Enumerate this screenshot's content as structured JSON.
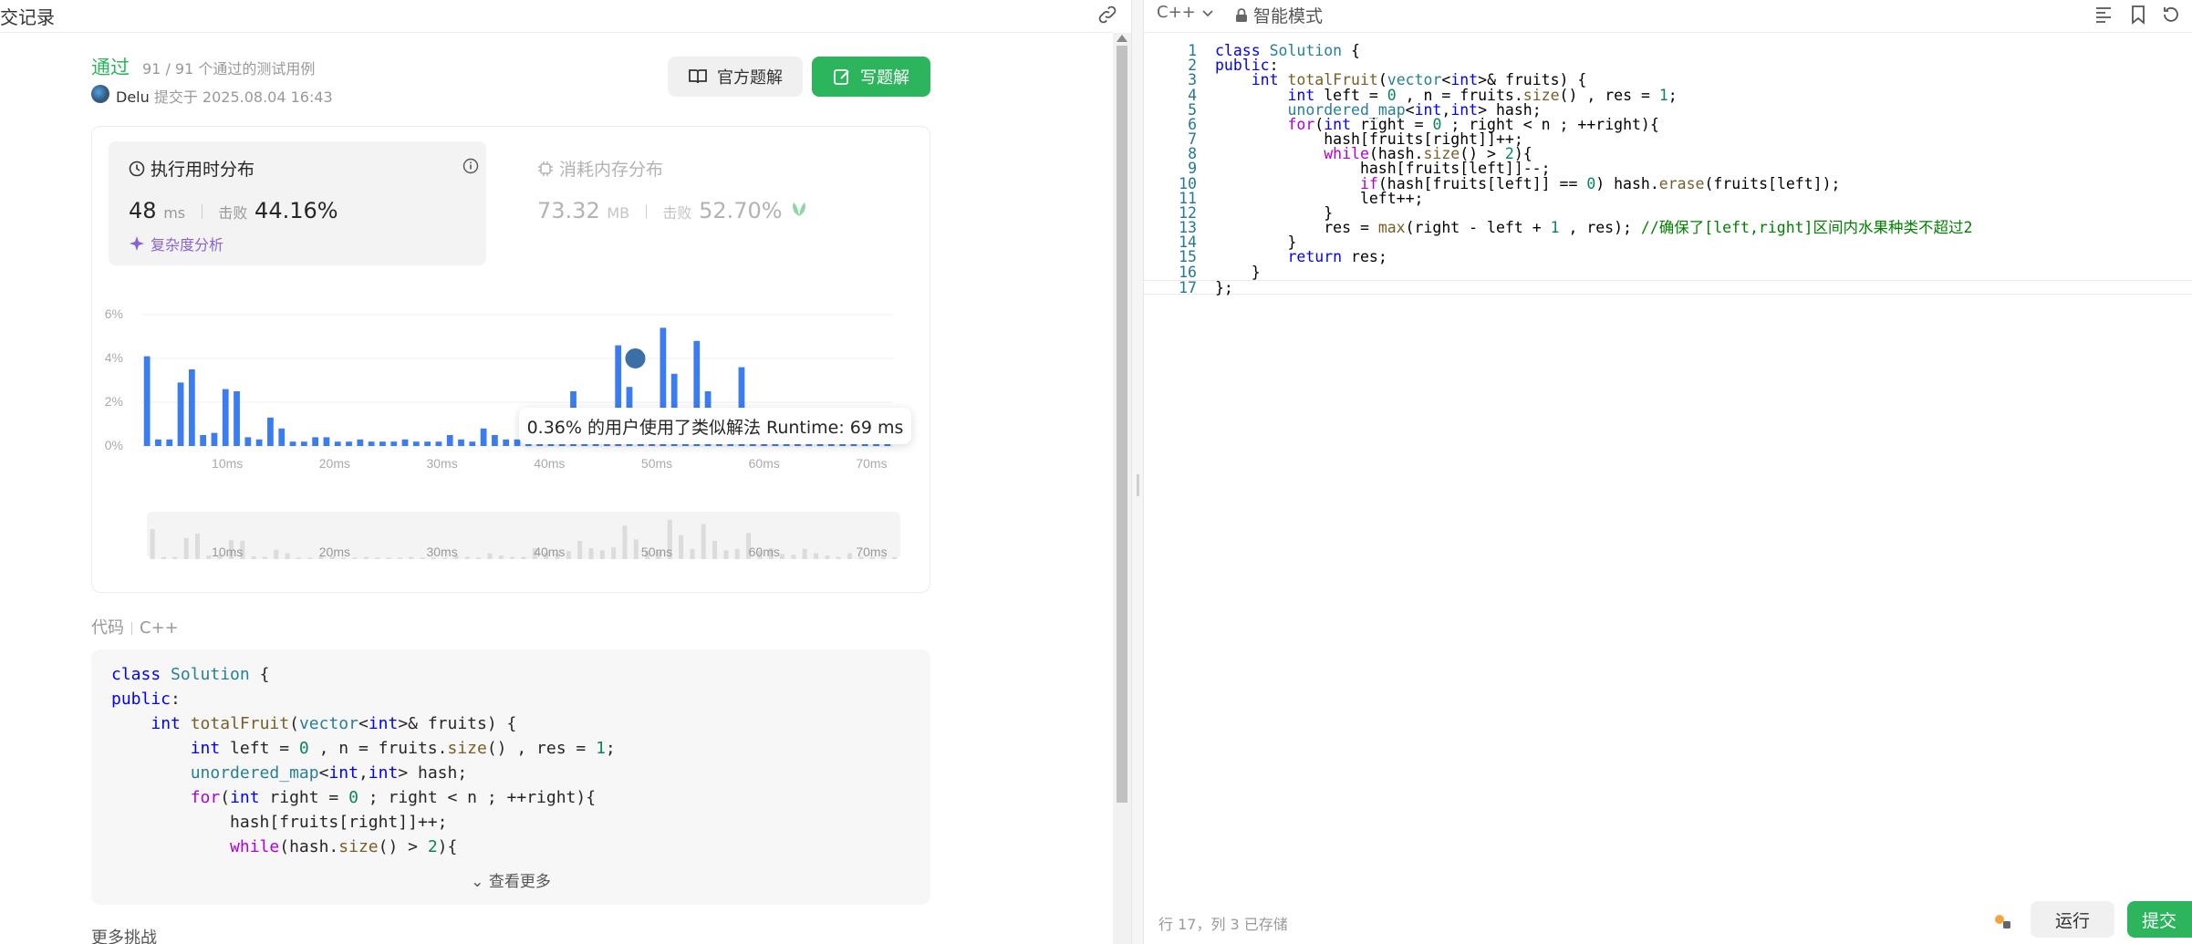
{
  "left": {
    "tab_title": "交记录",
    "status": "通过",
    "testcases": "91 / 91 个通过的测试用例",
    "submitter": "Delu",
    "submit_time": "提交于 2025.08.04 16:43",
    "btn_official": "官方题解",
    "btn_write": "写题解"
  },
  "perf": {
    "runtime_title": "执行用时分布",
    "runtime_value": "48",
    "runtime_unit": "ms",
    "beat_label": "击败",
    "runtime_beat": "44.16%",
    "complexity": "复杂度分析",
    "memory_title": "消耗内存分布",
    "memory_value": "73.32",
    "memory_unit": "MB",
    "memory_beat": "52.70%",
    "tooltip": "0.36% 的用户使用了类似解法 Runtime: 69 ms"
  },
  "chart_data": {
    "type": "bar",
    "title": "执行用时分布",
    "xlabel": "",
    "ylabel": "",
    "x_ticks": [
      "10ms",
      "20ms",
      "30ms",
      "40ms",
      "50ms",
      "60ms",
      "70ms"
    ],
    "y_ticks": [
      "6%",
      "4%",
      "2%",
      "0%"
    ],
    "ylim": [
      0,
      6
    ],
    "x_range_ms": [
      2,
      72
    ],
    "values": [
      4.1,
      0.3,
      0.3,
      2.9,
      3.5,
      0.5,
      0.6,
      2.6,
      2.5,
      0.4,
      0.3,
      1.3,
      0.8,
      0.2,
      0.2,
      0.4,
      0.4,
      0.2,
      0.2,
      0.3,
      0.2,
      0.2,
      0.2,
      0.3,
      0.2,
      0.2,
      0.2,
      0.5,
      0.3,
      0.2,
      0.8,
      0.5,
      0.3,
      0.3,
      1.5,
      0.9,
      0.8,
      1.1,
      2.5,
      1.5,
      1.2,
      1.6,
      4.6,
      2.7,
      1.1,
      1.0,
      5.4,
      3.3,
      1.4,
      4.8,
      2.5,
      1.2,
      1.4,
      3.6,
      1.2,
      1.5,
      0.7,
      0.6,
      1.4,
      0.8,
      0.5,
      0.3,
      0.8,
      0.3,
      0.3,
      0.3,
      0.3
    ],
    "highlight_ms": 48,
    "grid": true
  },
  "code_section": {
    "label": "代码",
    "lang": "C++",
    "show_more": "查看更多",
    "more_challenges": "更多挑战"
  },
  "editor": {
    "lang": "C++",
    "mode": "智能模式",
    "status": "行 17，列 3    已存储",
    "run": "运行",
    "submit": "提交",
    "lines": [
      "class Solution {",
      "public:",
      "    int totalFruit(vector<int>& fruits) {",
      "        int left = 0 , n = fruits.size() , res = 1;",
      "        unordered_map<int,int> hash;",
      "        for(int right = 0 ; right < n ; ++right){",
      "            hash[fruits[right]]++;",
      "            while(hash.size() > 2){",
      "                hash[fruits[left]]--;",
      "                if(hash[fruits[left]] == 0) hash.erase(fruits[left]);",
      "                left++;",
      "            }",
      "            res = max(right - left + 1 , res); //确保了[left,right]区间内水果种类不超过2",
      "        }",
      "        return res;",
      "    }",
      "};"
    ]
  },
  "colors": {
    "accent_green": "#2db55d",
    "bar_blue": "#3b7cf0",
    "complexity_purple": "#8a63d2"
  }
}
